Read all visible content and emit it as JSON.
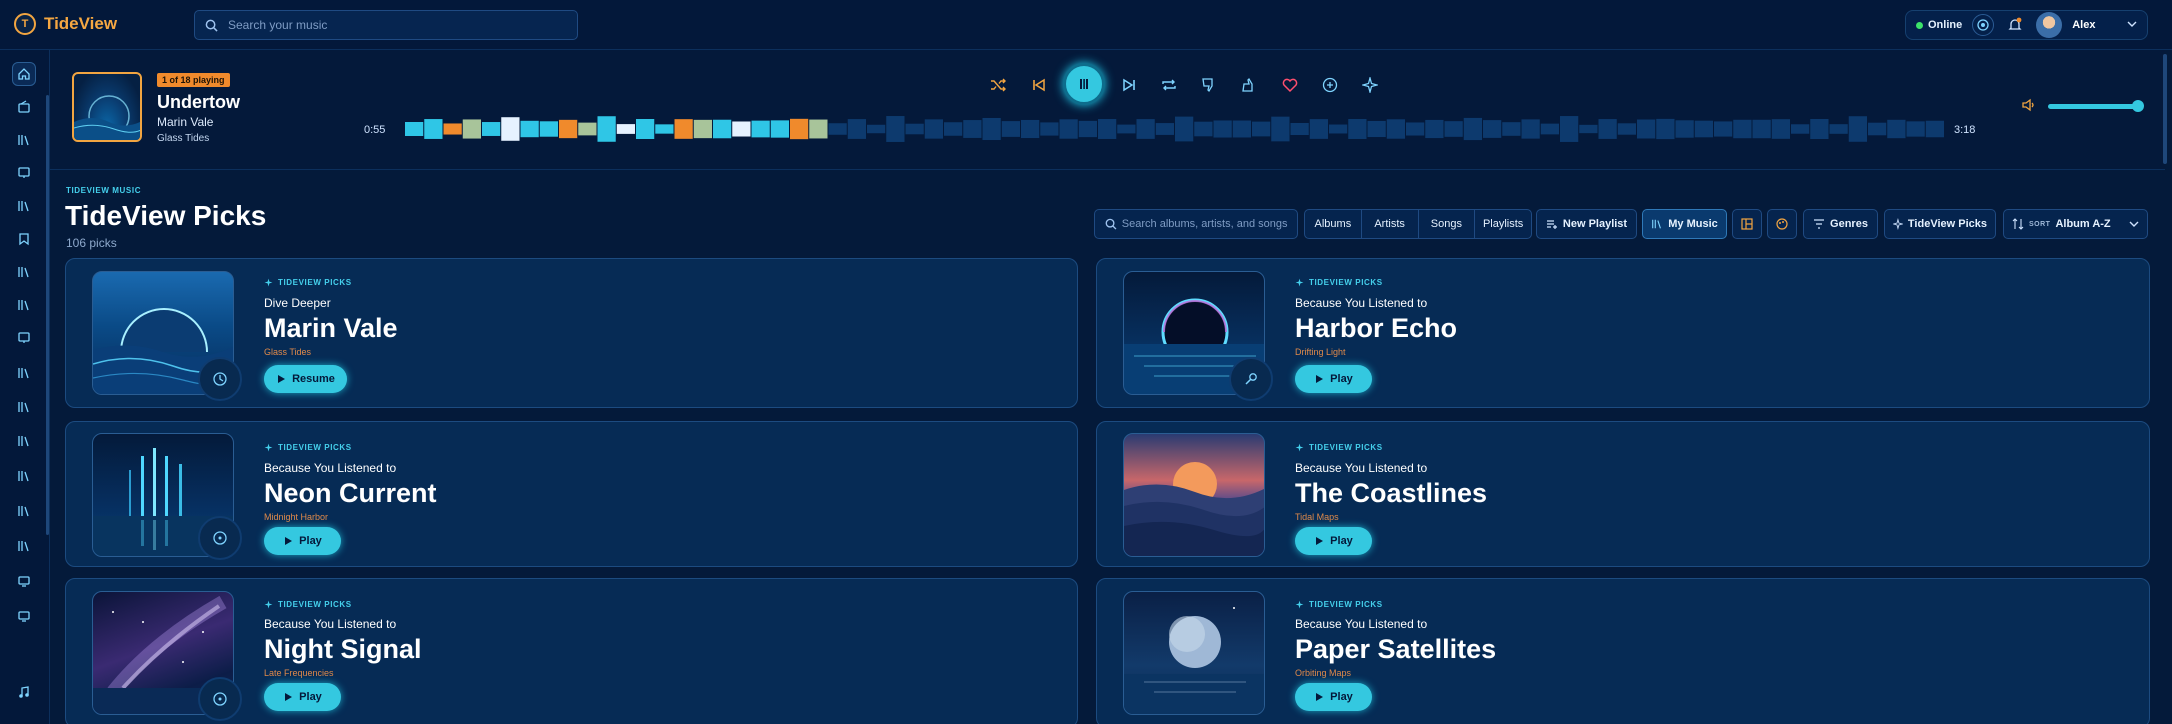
{
  "app": {
    "name": "TideView"
  },
  "search": {
    "placeholder": "Search your music"
  },
  "user": {
    "status": "Online",
    "name": "Alex"
  },
  "now_playing": {
    "badge": "1 of 18 playing",
    "title": "Undertow",
    "artist": "Marin Vale",
    "album": "Glass Tides",
    "elapsed": "0:55",
    "total": "3:18",
    "progress": 0.28,
    "volume": 0.95
  },
  "controls": [
    "shuffle-icon",
    "previous-icon",
    "pause-icon",
    "next-icon",
    "repeat-icon",
    "thumbs-down-icon",
    "thumbs-up-icon",
    "heart-icon",
    "add-icon",
    "sparkle-icon"
  ],
  "section": {
    "eyebrow": "TIDEVIEW MUSIC",
    "title": "TideView Picks",
    "count": "106 picks"
  },
  "toolbar": {
    "search_placeholder": "Search albums, artists, and songs",
    "tabs": [
      "Albums",
      "Artists",
      "Songs",
      "Playlists"
    ],
    "new_playlist": "New Playlist",
    "my_music": "My Music",
    "genres": "Genres",
    "picks": "TideView Picks",
    "sort_label": "SORT",
    "sort_value": "Album A-Z"
  },
  "cards": [
    {
      "eyebrow": "TIDEVIEW PICKS",
      "reason": "Dive Deeper",
      "title": "Marin Vale",
      "subtitle": "Glass Tides",
      "button": "Resume",
      "art": "wave-sunrise"
    },
    {
      "eyebrow": "TIDEVIEW PICKS",
      "reason": "Because You Listened to",
      "title": "Harbor Echo",
      "subtitle": "Drifting Light",
      "button": "Play",
      "art": "ring-ocean"
    },
    {
      "eyebrow": "TIDEVIEW PICKS",
      "reason": "Because You Listened to",
      "title": "Neon Current",
      "subtitle": "Midnight Harbor",
      "button": "Play",
      "art": "neon-bars"
    },
    {
      "eyebrow": "TIDEVIEW PICKS",
      "reason": "Because You Listened to",
      "title": "The Coastlines",
      "subtitle": "Tidal Maps",
      "button": "Play",
      "art": "sunset-dunes"
    },
    {
      "eyebrow": "TIDEVIEW PICKS",
      "reason": "Because You Listened to",
      "title": "Night Signal",
      "subtitle": "Late Frequencies",
      "button": "Play",
      "art": "galaxy-sea"
    },
    {
      "eyebrow": "TIDEVIEW PICKS",
      "reason": "Because You Listened to",
      "title": "Paper Satellites",
      "subtitle": "Orbiting Maps",
      "button": "Play",
      "art": "moon-sea"
    }
  ],
  "colors": {
    "accent": "#34c8e0",
    "brand": "#f5a742",
    "background": "#041a3a",
    "card": "#062b55"
  }
}
